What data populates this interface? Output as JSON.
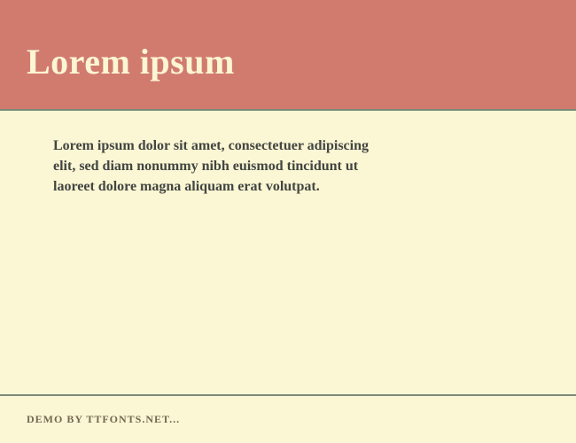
{
  "header": {
    "title": "Lorem ipsum"
  },
  "content": {
    "body": "Lorem ipsum dolor sit amet, consectetuer adipiscing elit, sed diam nonummy nibh euismod tincidunt ut laoreet dolore magna aliquam erat volutpat."
  },
  "footer": {
    "text": "DEMO BY TTFONTS.NET..."
  }
}
